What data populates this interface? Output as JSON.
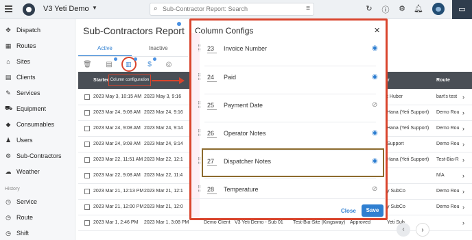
{
  "header": {
    "app_title": "V3 Yeti Demo",
    "search_placeholder": "Sub-Contractor Report: Search"
  },
  "sidebar": {
    "items": [
      {
        "label": "Dispatch",
        "icon": "dispatch-icon",
        "glyph": "✥"
      },
      {
        "label": "Routes",
        "icon": "routes-icon",
        "glyph": "▦"
      },
      {
        "label": "Sites",
        "icon": "sites-icon",
        "glyph": "⌂"
      },
      {
        "label": "Clients",
        "icon": "clients-icon",
        "glyph": "▤"
      },
      {
        "label": "Services",
        "icon": "services-icon",
        "glyph": "✎"
      },
      {
        "label": "Equipment",
        "icon": "equipment-icon",
        "glyph": "⛟"
      },
      {
        "label": "Consumables",
        "icon": "consumables-icon",
        "glyph": "◆"
      },
      {
        "label": "Users",
        "icon": "users-icon",
        "glyph": "♟"
      },
      {
        "label": "Sub-Contractors",
        "icon": "subcontractors-icon",
        "glyph": "⚙"
      },
      {
        "label": "Weather",
        "icon": "weather-icon",
        "glyph": "☁"
      }
    ],
    "history_header": "History",
    "history_items": [
      {
        "label": "Service",
        "icon": "service-icon",
        "glyph": "◷"
      },
      {
        "label": "Route",
        "icon": "route-icon",
        "glyph": "◷"
      },
      {
        "label": "Shift",
        "icon": "shift-icon",
        "glyph": "◷"
      }
    ]
  },
  "main": {
    "title": "Sub-Contractors Report",
    "tabs": [
      {
        "label": "Active"
      },
      {
        "label": "Inactive"
      }
    ],
    "tooltip": "Column configuration",
    "columns": [
      "Started",
      "r",
      "Route"
    ],
    "rows": [
      {
        "c1": "2023 May 3, 10:15 AM",
        "c2": "2023 May 3, 9:16",
        "c3": "",
        "c4": "",
        "c5": "",
        "c6": "",
        "c7": "t Huber",
        "c8": "bart's test"
      },
      {
        "c1": "2023 Mar 24, 9:08 AM",
        "c2": "2023 Mar 24, 9:16",
        "c3": "",
        "c4": "",
        "c5": "",
        "c6": "",
        "c7": "Hana (Yeti Support)",
        "c8": "Demo Rou"
      },
      {
        "c1": "2023 Mar 24, 9:08 AM",
        "c2": "2023 Mar 24, 9:14",
        "c3": "",
        "c4": "",
        "c5": "",
        "c6": "",
        "c7": "Hana (Yeti Support)",
        "c8": "Demo Rou"
      },
      {
        "c1": "2023 Mar 24, 9:08 AM",
        "c2": "2023 Mar 24, 9:14",
        "c3": "",
        "c4": "",
        "c5": "",
        "c6": "",
        "c7": "Support",
        "c8": "Demo Rou"
      },
      {
        "c1": "2023 Mar 22, 11:51 AM",
        "c2": "2023 Mar 22, 12:1",
        "c3": "",
        "c4": "",
        "c5": "",
        "c6": "",
        "c7": "Hana (Yeti Support)",
        "c8": "Test-Bia-R"
      },
      {
        "c1": "2023 Mar 22, 9:08 AM",
        "c2": "2023 Mar 22, 11:4",
        "c3": "",
        "c4": "",
        "c5": "",
        "c6": "",
        "c7": "",
        "c8": "N/A"
      },
      {
        "c1": "2023 Mar 21, 12:13 PM",
        "c2": "2023 Mar 21, 12:1",
        "c3": "",
        "c4": "",
        "c5": "",
        "c6": "",
        "c7": "y SubCo",
        "c8": "Demo Rou"
      },
      {
        "c1": "2023 Mar 21, 12:00 PM",
        "c2": "2023 Mar 21, 12:0",
        "c3": "",
        "c4": "",
        "c5": "",
        "c6": "",
        "c7": "y SubCo",
        "c8": "Demo Rou"
      },
      {
        "c1": "2023 Mar 1, 2:46 PM",
        "c2": "2023 Mar 1, 3:08 PM",
        "c3": "Demo Client",
        "c4": "V3 Yeti Demo - Sub 01",
        "c5": "Test-Bia-Site (Kingsway)",
        "c6": "Approved",
        "c7": "Yeti Sub",
        "c8": ""
      }
    ]
  },
  "modal": {
    "title": "Column Configs",
    "items": [
      {
        "num": "23",
        "label": "Invoice Number",
        "visible": true
      },
      {
        "num": "24",
        "label": "Paid",
        "visible": true
      },
      {
        "num": "25",
        "label": "Payment Date",
        "visible": false
      },
      {
        "num": "26",
        "label": "Operator Notes",
        "visible": true
      },
      {
        "num": "27",
        "label": "Dispatcher Notes",
        "visible": true
      },
      {
        "num": "28",
        "label": "Temperature",
        "visible": false
      }
    ],
    "close_label": "Close",
    "save_label": "Save"
  },
  "colors": {
    "accent": "#2f7fd1",
    "annotation_red": "#d9442c",
    "highlight_brown": "#8c6a2e",
    "header_dark": "#4a4f56"
  }
}
